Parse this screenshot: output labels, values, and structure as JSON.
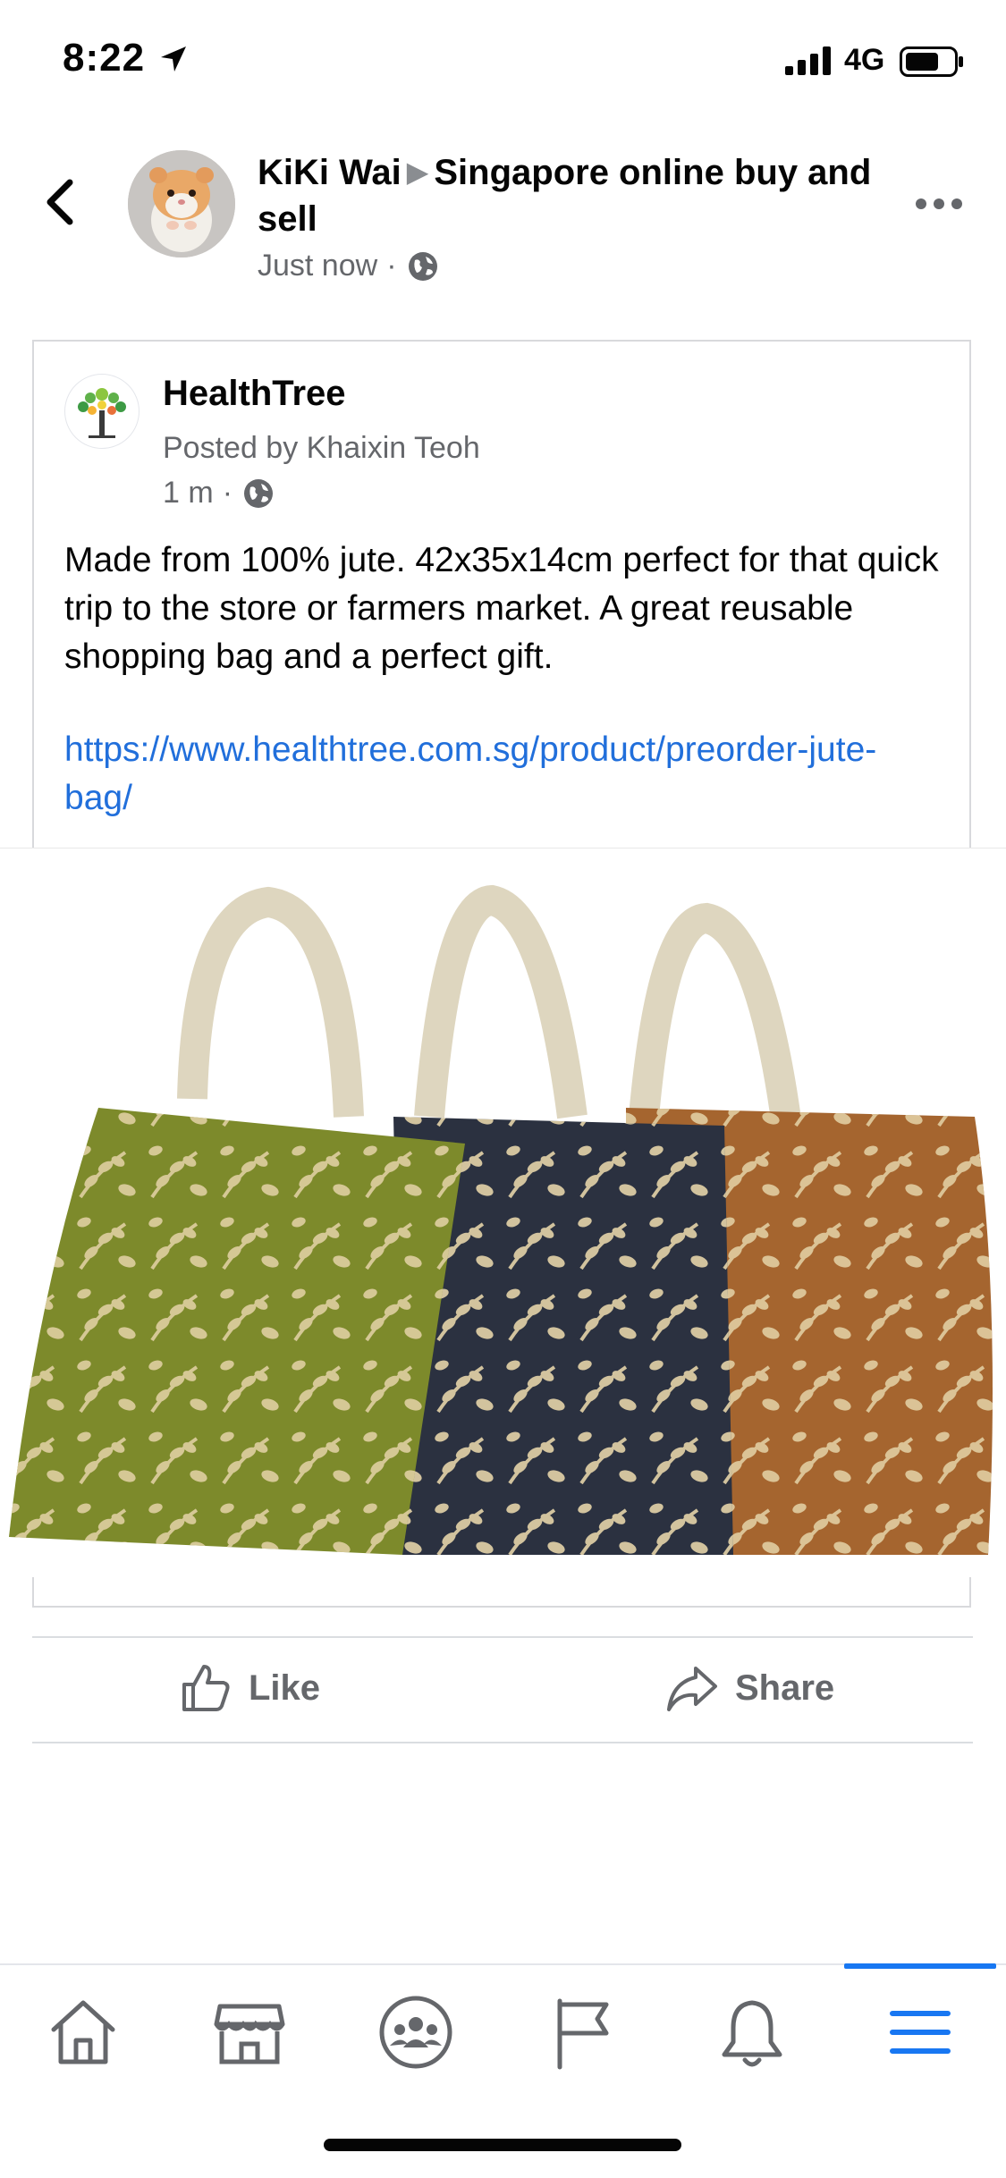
{
  "status_bar": {
    "time": "8:22",
    "network": "4G",
    "icons": [
      "location-arrow-icon",
      "signal-icon",
      "battery-icon"
    ]
  },
  "post": {
    "author": "KiKi Wai",
    "separator": "▶",
    "group": "Singapore online buy and sell",
    "timestamp": "Just now",
    "meta_dot": "·",
    "privacy_icon": "globe-icon"
  },
  "shared_post": {
    "page_name": "HealthTree",
    "posted_by": "Posted by Khaixin Teoh",
    "timestamp": "1 m",
    "meta_dot": "·",
    "text": "Made from 100% jute. 42x35x14cm perfect for that quick trip to the store or farmers market. A great reusable shopping bag and a perfect gift.",
    "link": "https://www.healthtree.com.sg/product/preorder-jute-bag/"
  },
  "actions": {
    "like": "Like",
    "share": "Share"
  },
  "tabbar": {
    "tabs": [
      "home-icon",
      "marketplace-icon",
      "groups-icon",
      "pages-flag-icon",
      "notifications-icon",
      "menu-icon"
    ],
    "active": "menu-icon",
    "accent": "#1877f2"
  },
  "colors": {
    "link": "#216fdb",
    "secondary_text": "#65676b",
    "bag_green": "#7f8a2a",
    "bag_navy": "#2c3240",
    "bag_rust": "#a0602f"
  }
}
